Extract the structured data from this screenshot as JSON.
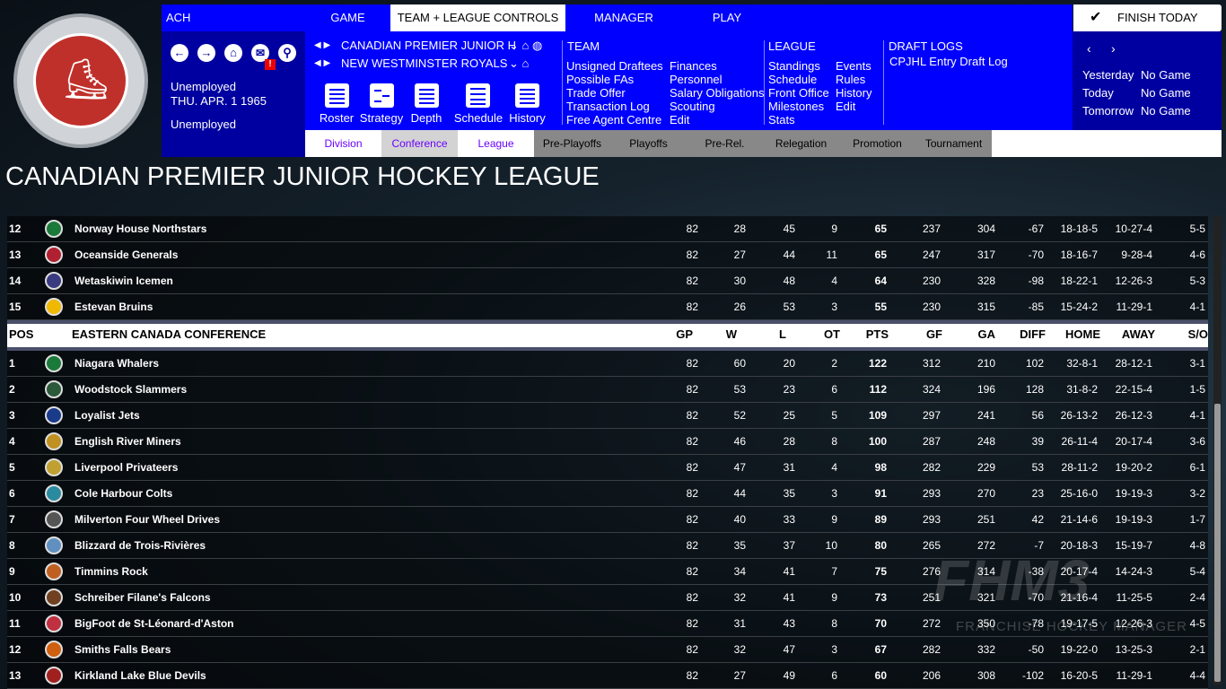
{
  "logo": {
    "text_top": "CANADIAN PREMIER",
    "text_bottom": "JUNIOR HOCKEY LEAGUE"
  },
  "topnav": {
    "left": "ACH",
    "tabs": [
      "GAME",
      "TEAM + LEAGUE CONTROLS",
      "MANAGER",
      "PLAY"
    ],
    "active": "TEAM + LEAGUE CONTROLS",
    "finish": "FINISH TODAY"
  },
  "leftpanel": {
    "status1": "Unemployed",
    "date": "THU. APR. 1 1965",
    "status2": "Unemployed",
    "alert": "!"
  },
  "selectors": {
    "league": "CANADIAN PREMIER JUNIOR H",
    "team": "NEW WESTMINSTER ROYALS"
  },
  "quick": [
    "Roster",
    "Strategy",
    "Depth",
    "Schedule",
    "History"
  ],
  "team_menu": {
    "title": "TEAM",
    "col1": [
      "Unsigned Draftees",
      "Possible FAs",
      "Trade Offer",
      "Transaction Log",
      "Free Agent Centre"
    ],
    "col2": [
      "Finances",
      "Personnel",
      "Salary Obligations",
      "Scouting",
      "Edit"
    ]
  },
  "league_menu": {
    "title": "LEAGUE",
    "col1": [
      "Standings",
      "Schedule",
      "Front Office",
      "Milestones",
      "Stats"
    ],
    "col2": [
      "Events",
      "Rules",
      "History",
      "Edit"
    ]
  },
  "draft_menu": {
    "title": "DRAFT LOGS",
    "items": [
      "CPJHL Entry Draft Log"
    ]
  },
  "games": [
    {
      "day": "Yesterday",
      "val": "No Game"
    },
    {
      "day": "Today",
      "val": "No Game"
    },
    {
      "day": "Tomorrow",
      "val": "No Game"
    }
  ],
  "subtabs": [
    "Division",
    "Conference",
    "League",
    "Pre-Playoffs",
    "Playoffs",
    "Pre-Rel.",
    "Relegation",
    "Promotion",
    "Tournament"
  ],
  "page_title": "CANADIAN PREMIER JUNIOR HOCKEY LEAGUE",
  "columns": [
    "POS",
    "EASTERN CANADA CONFERENCE",
    "GP",
    "W",
    "L",
    "OT",
    "PTS",
    "GF",
    "GA",
    "DIFF",
    "HOME",
    "AWAY",
    "S/O"
  ],
  "rows_top": [
    [
      "12",
      "Norway House Northstars",
      "82",
      "28",
      "45",
      "9",
      "65",
      "237",
      "304",
      "-67",
      "18-18-5",
      "10-27-4",
      "5-5",
      "#1a7a3a"
    ],
    [
      "13",
      "Oceanside Generals",
      "82",
      "27",
      "44",
      "11",
      "65",
      "247",
      "317",
      "-70",
      "18-16-7",
      "9-28-4",
      "4-6",
      "#b02030"
    ],
    [
      "14",
      "Wetaskiwin Icemen",
      "82",
      "30",
      "48",
      "4",
      "64",
      "230",
      "328",
      "-98",
      "18-22-1",
      "12-26-3",
      "5-3",
      "#3a3a80"
    ],
    [
      "15",
      "Estevan Bruins",
      "82",
      "26",
      "53",
      "3",
      "55",
      "230",
      "315",
      "-85",
      "15-24-2",
      "11-29-1",
      "4-1",
      "#f0b800"
    ]
  ],
  "rows_bottom": [
    [
      "1",
      "Niagara Whalers",
      "82",
      "60",
      "20",
      "2",
      "122",
      "312",
      "210",
      "102",
      "32-8-1",
      "28-12-1",
      "3-1",
      "#1a7a3a"
    ],
    [
      "2",
      "Woodstock Slammers",
      "82",
      "53",
      "23",
      "6",
      "112",
      "324",
      "196",
      "128",
      "31-8-2",
      "22-15-4",
      "1-5",
      "#2a5a3a"
    ],
    [
      "3",
      "Loyalist Jets",
      "82",
      "52",
      "25",
      "5",
      "109",
      "297",
      "241",
      "56",
      "26-13-2",
      "26-12-3",
      "4-1",
      "#1a3a8a"
    ],
    [
      "4",
      "English River Miners",
      "82",
      "46",
      "28",
      "8",
      "100",
      "287",
      "248",
      "39",
      "26-11-4",
      "20-17-4",
      "3-6",
      "#c09020"
    ],
    [
      "5",
      "Liverpool Privateers",
      "82",
      "47",
      "31",
      "4",
      "98",
      "282",
      "229",
      "53",
      "28-11-2",
      "19-20-2",
      "6-1",
      "#c0a030"
    ],
    [
      "6",
      "Cole Harbour Colts",
      "82",
      "44",
      "35",
      "3",
      "91",
      "293",
      "270",
      "23",
      "25-16-0",
      "19-19-3",
      "3-2",
      "#2a8aa0"
    ],
    [
      "7",
      "Milverton Four Wheel Drives",
      "82",
      "40",
      "33",
      "9",
      "89",
      "293",
      "251",
      "42",
      "21-14-6",
      "19-19-3",
      "1-7",
      "#555555"
    ],
    [
      "8",
      "Blizzard de Trois-Rivières",
      "82",
      "35",
      "37",
      "10",
      "80",
      "265",
      "272",
      "-7",
      "20-18-3",
      "15-19-7",
      "4-8",
      "#6090c0"
    ],
    [
      "9",
      "Timmins Rock",
      "82",
      "34",
      "41",
      "7",
      "75",
      "276",
      "314",
      "-38",
      "20-17-4",
      "14-24-3",
      "5-4",
      "#c06020"
    ],
    [
      "10",
      "Schreiber Filane's Falcons",
      "82",
      "32",
      "41",
      "9",
      "73",
      "251",
      "321",
      "-70",
      "21-16-4",
      "11-25-5",
      "2-4",
      "#704020"
    ],
    [
      "11",
      "BigFoot de St-Léonard-d'Aston",
      "82",
      "31",
      "43",
      "8",
      "70",
      "272",
      "350",
      "-78",
      "19-17-5",
      "12-26-3",
      "4-5",
      "#c03040"
    ],
    [
      "12",
      "Smiths Falls Bears",
      "82",
      "32",
      "47",
      "3",
      "67",
      "282",
      "332",
      "-50",
      "19-22-0",
      "13-25-3",
      "2-1",
      "#d06010"
    ],
    [
      "13",
      "Kirkland Lake Blue Devils",
      "82",
      "27",
      "49",
      "6",
      "60",
      "206",
      "308",
      "-102",
      "16-20-5",
      "11-29-1",
      "4-4",
      "#a02020"
    ]
  ],
  "watermark": {
    "big": "FHM3",
    "small": "FRANCHISE HOCKEY MANAGER"
  },
  "colors": {
    "nav_blue": "#0000ff",
    "panel_navy": "#0000a0",
    "subtab_text": "#6a00ff"
  }
}
